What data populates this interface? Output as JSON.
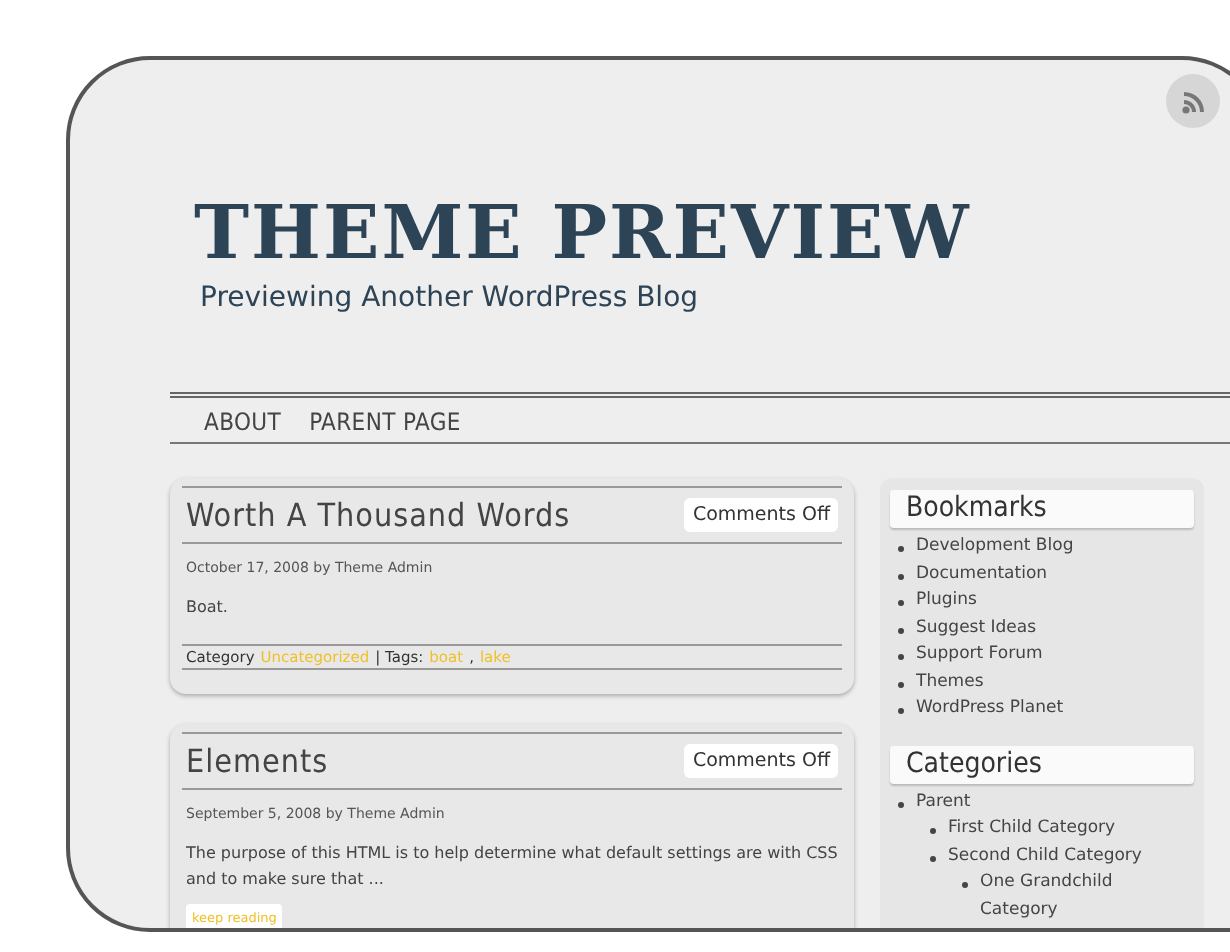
{
  "header": {
    "title": "THEME PREVIEW",
    "tagline": "Previewing Another WordPress Blog"
  },
  "nav": [
    {
      "label": "ABOUT"
    },
    {
      "label": "PARENT PAGE"
    }
  ],
  "posts": [
    {
      "title": "Worth A Thousand Words",
      "comments": "Comments Off",
      "meta": "October 17, 2008 by Theme Admin",
      "excerpt": "Boat.",
      "footer": {
        "category_label": "Category",
        "category": "Uncategorized",
        "tags_label": "| Tags:",
        "tags": [
          "boat",
          "lake"
        ],
        "tag_separator": ","
      }
    },
    {
      "title": "Elements",
      "comments": "Comments Off",
      "meta": "September 5, 2008 by Theme Admin",
      "excerpt": "The purpose of this HTML is to help determine what default settings are with CSS and to make sure that ...",
      "more": "keep reading"
    }
  ],
  "sidebar": [
    {
      "heading": "Bookmarks",
      "items": [
        {
          "label": "Development Blog"
        },
        {
          "label": "Documentation"
        },
        {
          "label": "Plugins"
        },
        {
          "label": "Suggest Ideas"
        },
        {
          "label": "Support Forum"
        },
        {
          "label": "Themes"
        },
        {
          "label": "WordPress Planet"
        }
      ]
    },
    {
      "heading": "Categories",
      "items": [
        {
          "label": "Parent",
          "children": [
            {
              "label": "First Child Category"
            },
            {
              "label": "Second Child Category",
              "children": [
                {
                  "label": "One Grandchild Category"
                }
              ]
            }
          ]
        }
      ]
    }
  ]
}
